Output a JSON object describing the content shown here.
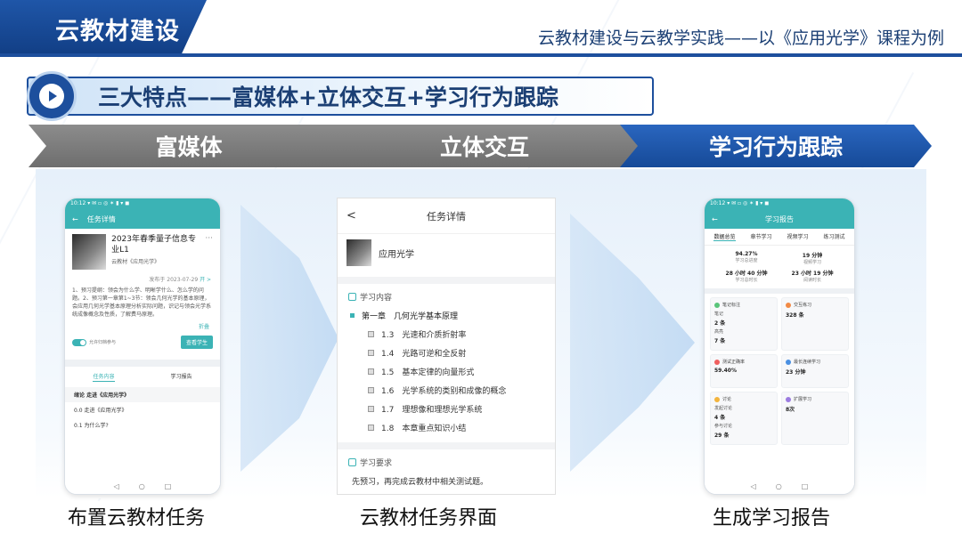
{
  "header": {
    "title": "云教材建设",
    "subtitle": "云教材建设与云教学实践——以《应用光学》课程为例"
  },
  "banner": {
    "text": "三大特点——富媒体+立体交互+学习行为跟踪"
  },
  "steps": [
    {
      "label": "富媒体"
    },
    {
      "label": "立体交互"
    },
    {
      "label": "学习行为跟踪"
    }
  ],
  "phone1": {
    "status": "10:12 ▾ ✉ ▫ ◎      ✶ ▮ ▾ ◼",
    "title": "任务详情",
    "course_name": "2023年春季量子信息专业L1",
    "course_sub": "云教材《应用光学》",
    "date": "发布于 2023-07-29",
    "date_more": "开 >",
    "dots": "···",
    "desc": "1、预习提纲：领会为什么学、明晰学什么、怎么学的问题。2、预习第一章第1~3节：领会几何光学的基本原理，会应用几何光学基本原理分析实际问题，识记与领会光学系统成像概念及性质，了解费马原理。",
    "more": "折叠",
    "toggle_label": "允许归档参与",
    "button": "查看学生",
    "tabs": [
      "任务内容",
      "学习报告"
    ],
    "chapters": [
      "绪论  走进《应用光学》",
      "0.0  走进《应用光学》",
      "0.1  为什么学?"
    ],
    "nav": [
      "◁",
      "○",
      "□"
    ]
  },
  "phone2": {
    "back": "<",
    "title": "任务详情",
    "book": "应用光学",
    "section1": "学习内容",
    "chapter": "第一章　几何光学基本原理",
    "items": [
      "1.3　光速和介质折射率",
      "1.4　光路可逆和全反射",
      "1.5　基本定律的向量形式",
      "1.6　光学系统的类别和成像的概念",
      "1.7　理想像和理想光学系统",
      "1.8　本章重点知识小结"
    ],
    "section2": "学习要求",
    "requirement": "先预习，再完成云教材中相关测试题。"
  },
  "phone3": {
    "status": "10:12 ▾ ✉ ▫ ◎      ✶ ▮ ▾ ◼",
    "back": "←",
    "title": "学习报告",
    "tabs": [
      "数据总览",
      "章节学习",
      "视频学习",
      "练习测试"
    ],
    "stats": [
      {
        "value": "94.27%",
        "label": "学习总进度"
      },
      {
        "value": "19 分钟",
        "label": "视频学习"
      },
      {
        "value": "28 小时 40 分钟",
        "label": "学习总时长"
      },
      {
        "value": "23 小时 19 分钟",
        "label": "阅读时长"
      }
    ],
    "cards": [
      {
        "title": "笔记标注",
        "color": "#59c47a",
        "lines": [
          [
            "笔记",
            "2 条"
          ],
          [
            "高亮",
            "7 条"
          ]
        ]
      },
      {
        "title": "交互练习",
        "color": "#f18a45",
        "lines": [
          [
            "",
            "328 条"
          ]
        ]
      },
      {
        "title": "",
        "color": "",
        "lines": []
      },
      {
        "title": "测试正确率",
        "color": "#ef5f5f",
        "lines": [
          [
            "",
            "59.40%"
          ]
        ]
      },
      {
        "title": "最长连续学习",
        "color": "#4a90e2",
        "lines": [
          [
            "",
            "23 分钟"
          ]
        ]
      },
      {
        "title": "讨论",
        "color": "#f3b43c",
        "lines": [
          [
            "发起讨论",
            "4 条"
          ]
        ]
      },
      {
        "title": "扩展学习",
        "color": "#9b7be0",
        "lines": [
          [
            "",
            "8次"
          ]
        ]
      },
      {
        "title": "",
        "color": "",
        "lines": [
          [
            "参与讨论",
            "29 条"
          ]
        ]
      }
    ],
    "nav": [
      "◁",
      "○",
      "□"
    ]
  },
  "captions": [
    "布置云教材任务",
    "云教材任务界面",
    "生成学习报告"
  ]
}
